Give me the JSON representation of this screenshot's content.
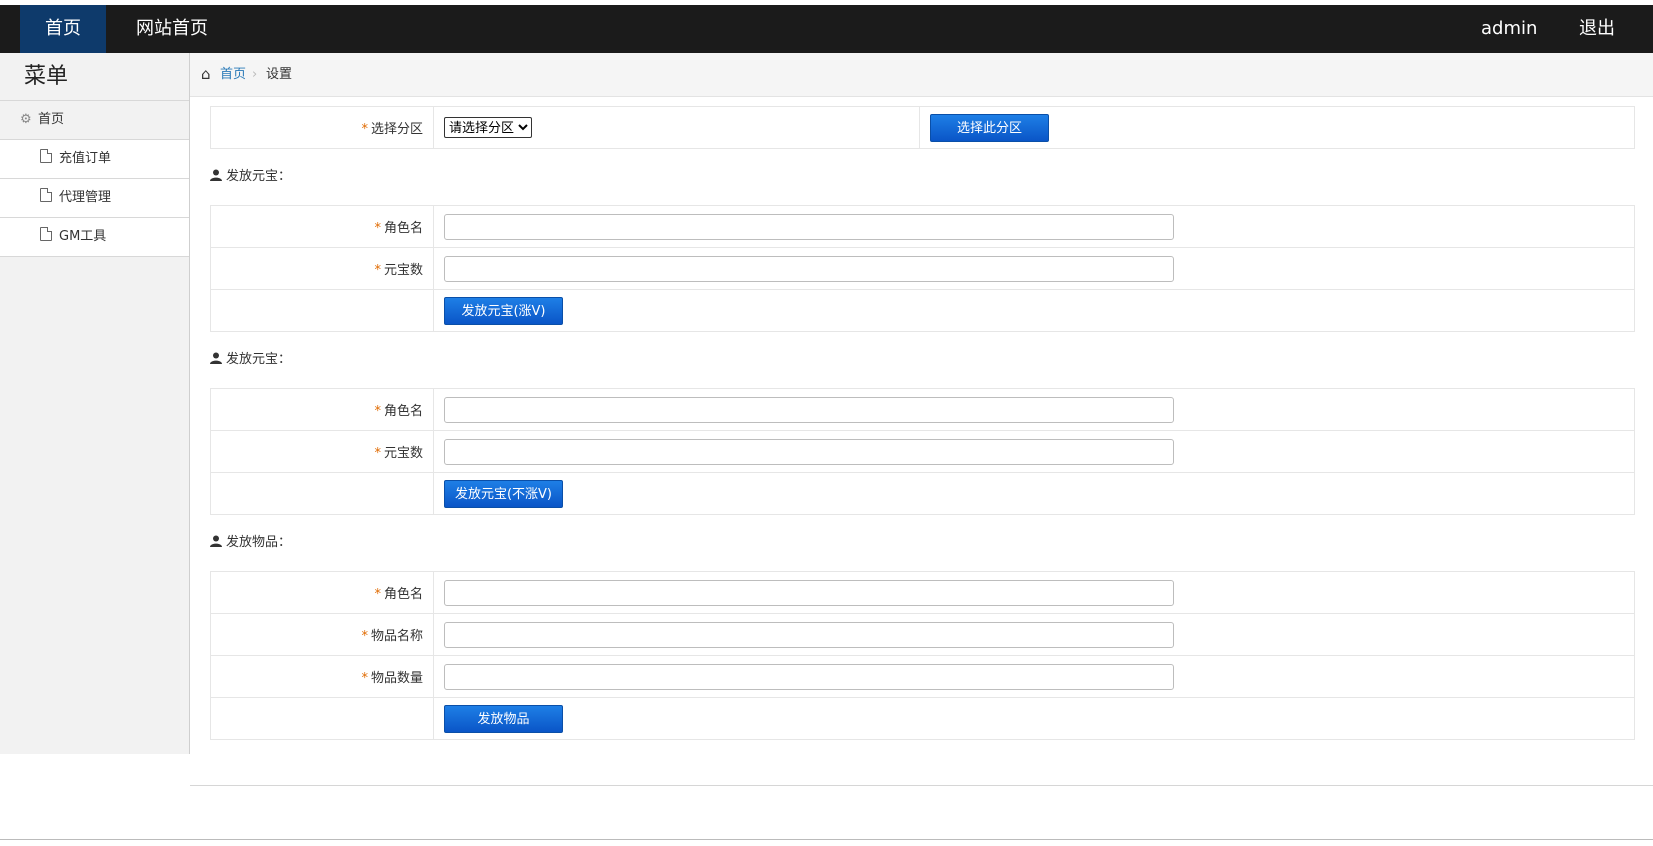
{
  "topbar": {
    "home_label": "首页",
    "site_label": "网站首页",
    "user_label": "admin",
    "logout_label": "退出",
    "bg_color": "#1b1b1b",
    "active_color": "#0e3a6b"
  },
  "sidebar": {
    "title": "菜单",
    "parent_label": "首页",
    "items": [
      {
        "label": "充值订单"
      },
      {
        "label": "代理管理"
      },
      {
        "label": "GM工具"
      }
    ]
  },
  "breadcrumb": {
    "home": "首页",
    "current": "设置"
  },
  "zone": {
    "label": "选择分区",
    "select_value": "请选择分区",
    "button": "选择此分区"
  },
  "sections": [
    {
      "title": "发放元宝：",
      "fields": [
        {
          "label": "角色名",
          "value": ""
        },
        {
          "label": "元宝数",
          "value": ""
        }
      ],
      "button": "发放元宝(涨V)"
    },
    {
      "title": "发放元宝：",
      "fields": [
        {
          "label": "角色名",
          "value": ""
        },
        {
          "label": "元宝数",
          "value": ""
        }
      ],
      "button": "发放元宝(不涨V)"
    },
    {
      "title": "发放物品：",
      "fields": [
        {
          "label": "角色名",
          "value": ""
        },
        {
          "label": "物品名称",
          "value": ""
        },
        {
          "label": "物品数量",
          "value": ""
        }
      ],
      "button": "发放物品"
    }
  ],
  "colors": {
    "accent_button": "#0a55c7",
    "required_marker": "#e06a00",
    "link": "#2a7ab8"
  }
}
